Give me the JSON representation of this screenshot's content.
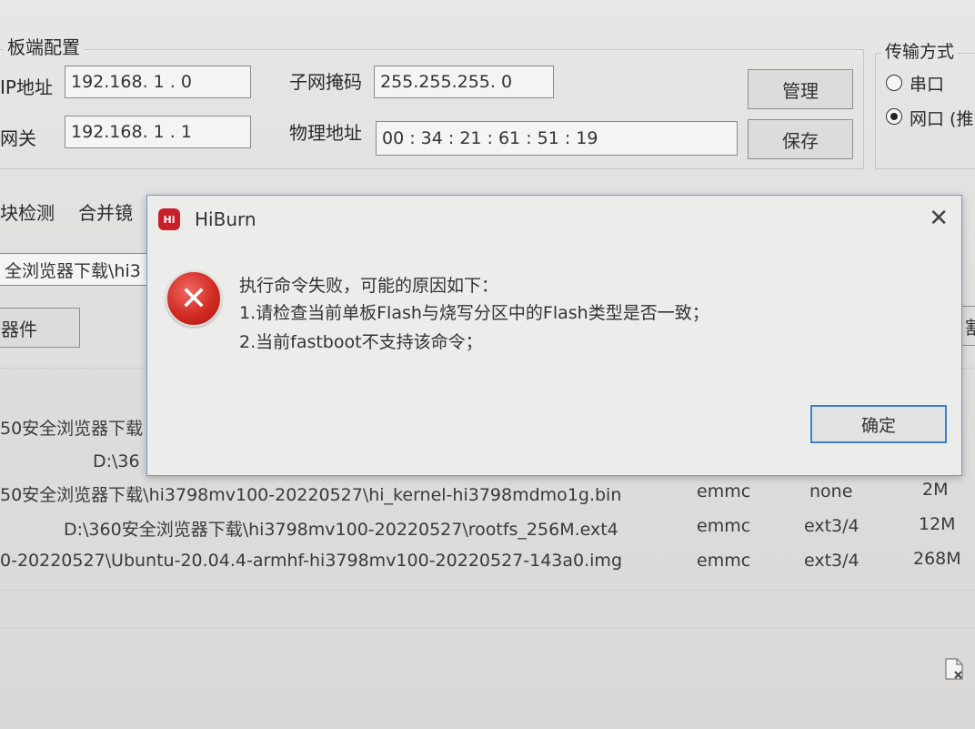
{
  "board_config": {
    "group_label": "板端配置",
    "ip_label": "IP地址",
    "ip_value": "192.168. 1 . 0",
    "gateway_label": "网关",
    "gateway_value": "192.168. 1 . 1",
    "subnet_label": "子网掩码",
    "subnet_value": "255.255.255. 0",
    "mac_label": "物理地址",
    "mac_value": "00 : 34 : 21 : 61 : 51 : 19",
    "manage_button": "管理",
    "save_button": "保存"
  },
  "transfer": {
    "group_label": "传输方式",
    "serial_label": "串口",
    "network_label": "网口 (推"
  },
  "tabs": {
    "tab1": "块检测",
    "tab2": "合并镜"
  },
  "path_field": "全浏览器下载\\hi3",
  "component_button": "器件",
  "right_edge_button": "割",
  "file_rows": [
    {
      "path": "50安全浏览器下载",
      "type": "",
      "fs": "",
      "size": ""
    },
    {
      "path": "D:\\36",
      "type": "",
      "fs": "",
      "size": ""
    },
    {
      "path": "50安全浏览器下载\\hi3798mv100-20220527\\hi_kernel-hi3798mdmo1g.bin",
      "type": "emmc",
      "fs": "none",
      "size": "2M"
    },
    {
      "path": "D:\\360安全浏览器下载\\hi3798mv100-20220527\\rootfs_256M.ext4",
      "type": "emmc",
      "fs": "ext3/4",
      "size": "12M"
    },
    {
      "path": "0-20220527\\Ubuntu-20.04.4-armhf-hi3798mv100-20220527-143a0.img",
      "type": "emmc",
      "fs": "ext3/4",
      "size": "268M"
    }
  ],
  "dialog": {
    "title": "HiBurn",
    "logo_text": "Hi",
    "line1": "执行命令失败，可能的原因如下：",
    "line2": "1.请检查当前单板Flash与烧写分区中的Flash类型是否一致；",
    "line3": "2.当前fastboot不支持该命令；",
    "ok_button": "确定",
    "close_glyph": "✕",
    "error_glyph": "✕"
  },
  "icons": {
    "error": "error-icon",
    "close": "close-icon",
    "file": "file-icon"
  },
  "colors": {
    "dialog_border": "#6f9bd1",
    "error_red": "#d12a22",
    "ok_focus": "#3c7fd0"
  }
}
